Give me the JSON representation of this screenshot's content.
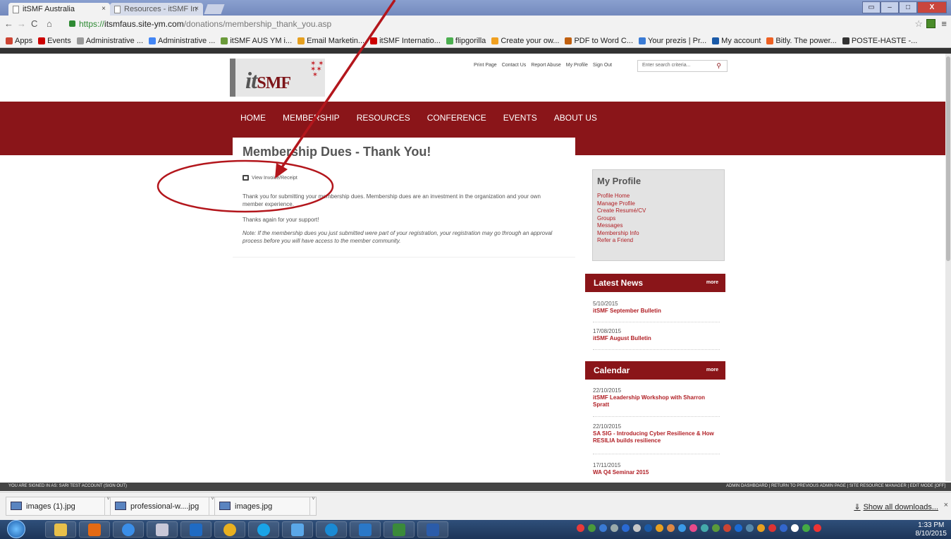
{
  "browser": {
    "tabs": [
      {
        "title": "itSMF Australia",
        "active": true
      },
      {
        "title": "Resources - itSMF In",
        "active": false
      }
    ],
    "url": {
      "scheme": "https://",
      "host": "itsmfaus.site-ym.com",
      "path": "/donations/membership_thank_you.asp"
    },
    "bookmarks": [
      {
        "label": "Apps",
        "color": "#c43"
      },
      {
        "label": "Events",
        "color": "#c00"
      },
      {
        "label": "Administrative ...",
        "color": "#999"
      },
      {
        "label": "Administrative ...",
        "color": "#4285f4"
      },
      {
        "label": "itSMF AUS YM i...",
        "color": "#6a9a3a"
      },
      {
        "label": "Email Marketin...",
        "color": "#e6a020"
      },
      {
        "label": "itSMF Internatio...",
        "color": "#c00"
      },
      {
        "label": "flipgorilla",
        "color": "#4caf50"
      },
      {
        "label": "Create your ow...",
        "color": "#f0a020"
      },
      {
        "label": "PDF to Word C...",
        "color": "#c06010"
      },
      {
        "label": "Your prezis | Pr...",
        "color": "#3a7bd5"
      },
      {
        "label": "My account",
        "color": "#1a5aa8"
      },
      {
        "label": "Bitly. The power...",
        "color": "#ee6123"
      },
      {
        "label": "POSTE-HASTE -...",
        "color": "#333"
      }
    ]
  },
  "site": {
    "logo_text": "it",
    "logo_text_2": "SMF",
    "utility_links": [
      "Print Page",
      "Contact Us",
      "Report Abuse",
      "My Profile",
      "Sign Out"
    ],
    "search_placeholder": "Enter search criteria...",
    "nav": [
      "HOME",
      "MEMBERSHIP",
      "RESOURCES",
      "CONFERENCE",
      "EVENTS",
      "ABOUT US"
    ]
  },
  "main": {
    "title": "Membership Dues - Thank You!",
    "print_link": "View Invoice/Receipt",
    "para1": "Thank you for submitting your membership dues. Membership dues are an investment in the organization and your own member experience.",
    "para2": "Thanks again for your support!",
    "note": "Note: If the membership dues you just submitted were part of your registration, your registration may go through an approval process before you will have access to the member community."
  },
  "sidebar": {
    "profile_title": "My Profile",
    "profile_links": [
      "Profile Home",
      "Manage Profile",
      "Create Resumé/CV",
      "Groups",
      "Messages",
      "Membership Info",
      "Refer a Friend"
    ],
    "news_title": "Latest News",
    "news_more": "more",
    "news": [
      {
        "date": "5/10/2015",
        "title": "itSMF September Bulletin"
      },
      {
        "date": "17/08/2015",
        "title": "itSMF August Bulletin"
      }
    ],
    "calendar_title": "Calendar",
    "calendar_more": "more",
    "calendar": [
      {
        "date": "22/10/2015",
        "title": "itSMF Leadership Workshop with Sharron Spratt"
      },
      {
        "date": "22/10/2015",
        "title": "SA SIG - Introducing Cyber Resilience & How RESILIA builds resilience"
      },
      {
        "date": "17/11/2015",
        "title": "WA Q4 Seminar 2015"
      }
    ]
  },
  "admin_bar": {
    "left": "YOU ARE SIGNED IN AS: SARI TEST ACCOUNT (SIGN OUT)",
    "right": "ADMIN DASHBOARD | RETURN TO PREVIOUS ADMIN PAGE | SITE RESOURCE MANAGER | EDIT MODE [OFF]"
  },
  "downloads": {
    "files": [
      "images (1).jpg",
      "professional-w....jpg",
      "images.jpg"
    ],
    "show_all": "Show all downloads..."
  },
  "taskbar": {
    "time": "1:33 PM",
    "date": "8/10/2015"
  },
  "colors": {
    "brand": "#8a1519",
    "link": "#b12026"
  }
}
